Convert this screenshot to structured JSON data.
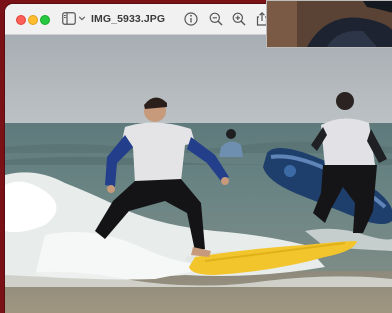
{
  "window": {
    "filename": "IMG_5933.JPG"
  },
  "toolbar": {
    "icons": [
      "sidebar-icon",
      "chevron-down-icon",
      "info-icon",
      "zoom-out-icon",
      "zoom-in-icon",
      "share-icon"
    ]
  },
  "colors": {
    "close": "#fe5f57",
    "minimize": "#febc2e",
    "zoom": "#28c840",
    "desktop": "#7a1116",
    "board": "#f3c52c"
  }
}
